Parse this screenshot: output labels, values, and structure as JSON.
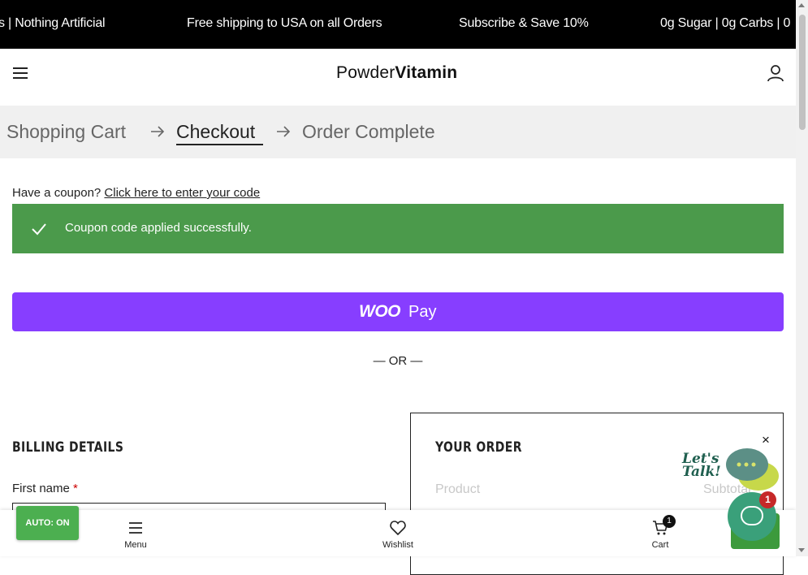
{
  "announcement": {
    "items": [
      "s | Nothing Artificial",
      "Free shipping to USA on all Orders",
      "Subscribe & Save 10%",
      "0g Sugar | 0g Carbs | 0"
    ]
  },
  "header": {
    "logo_part1": "Powder",
    "logo_part2": "Vitamin",
    "menu_icon": "hamburger-icon",
    "account_icon": "user-icon"
  },
  "breadcrumb": {
    "steps": [
      "Shopping Cart",
      "Checkout",
      "Order Complete"
    ],
    "active_step": "Checkout"
  },
  "coupon": {
    "prompt": "Have a coupon?",
    "link": "Click here to enter your code"
  },
  "notice": {
    "message": "Coupon code applied successfully.",
    "color": "#4b9a4b"
  },
  "express": {
    "woopay_brand": "WOO",
    "woopay_suffix": "Pay",
    "color": "#873eff",
    "separator": "— OR —"
  },
  "billing": {
    "title": "BILLING DETAILS",
    "first_name_label": "First name",
    "required_mark": "*"
  },
  "order": {
    "title": "YOUR ORDER",
    "col_product": "Product",
    "col_subtotal": "Subtotal"
  },
  "chat": {
    "badge_count": "1",
    "close_glyph": "×",
    "bubble_color": "#3aa07a"
  },
  "bottom_nav": {
    "items": [
      {
        "label": "Menu",
        "icon": "menu-icon"
      },
      {
        "label": "Wishlist",
        "icon": "heart-icon"
      },
      {
        "label": "Cart",
        "icon": "cart-icon"
      }
    ],
    "cart_count": "1"
  },
  "auto_button": {
    "label": "AUTO: ON"
  }
}
